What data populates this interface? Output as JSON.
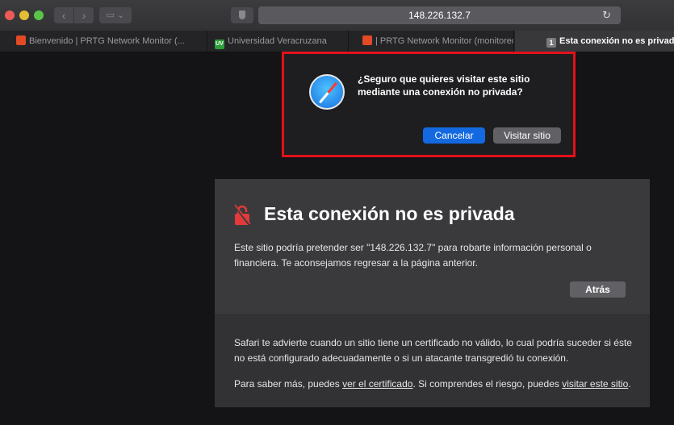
{
  "toolbar": {
    "nav_back": "‹",
    "nav_forward": "›",
    "sidebar": "▭ ⌄",
    "url": "148.226.132.7",
    "reload": "↻"
  },
  "tabs": [
    {
      "label": "Bienvenido | PRTG Network Monitor (...",
      "favicon": "prtg"
    },
    {
      "label": "Universidad Veracruzana",
      "favicon": "uv",
      "favicon_text": "UV"
    },
    {
      "label": "| PRTG Network Monitor (monitoreo...",
      "favicon": "prtg"
    },
    {
      "label": "Esta conexión no es privada",
      "favicon": "num",
      "favicon_text": "1",
      "active": true
    }
  ],
  "sheet": {
    "message": "¿Seguro que quieres visitar este sitio mediante una conexión no privada?",
    "cancel_label": "Cancelar",
    "visit_label": "Visitar sitio",
    "highlight_color": "#e4101a"
  },
  "warning": {
    "title": "Esta conexión no es privada",
    "body": "Este sitio podría pretender ser \"148.226.132.7\" para robarte información personal o financiera. Te aconsejamos regresar a la página anterior.",
    "back_label": "Atrás",
    "info": "Safari te advierte cuando un sitio tiene un certificado no válido, lo cual podría suceder si éste no está configurado adecuadamente o si un atacante transgredió tu conexión.",
    "more_prefix": "Para saber más, puedes ",
    "more_link_cert": "ver el certificado",
    "more_middle": ". Si comprendes el riesgo, puedes ",
    "more_link_visit": "visitar este sitio",
    "more_suffix": "."
  }
}
